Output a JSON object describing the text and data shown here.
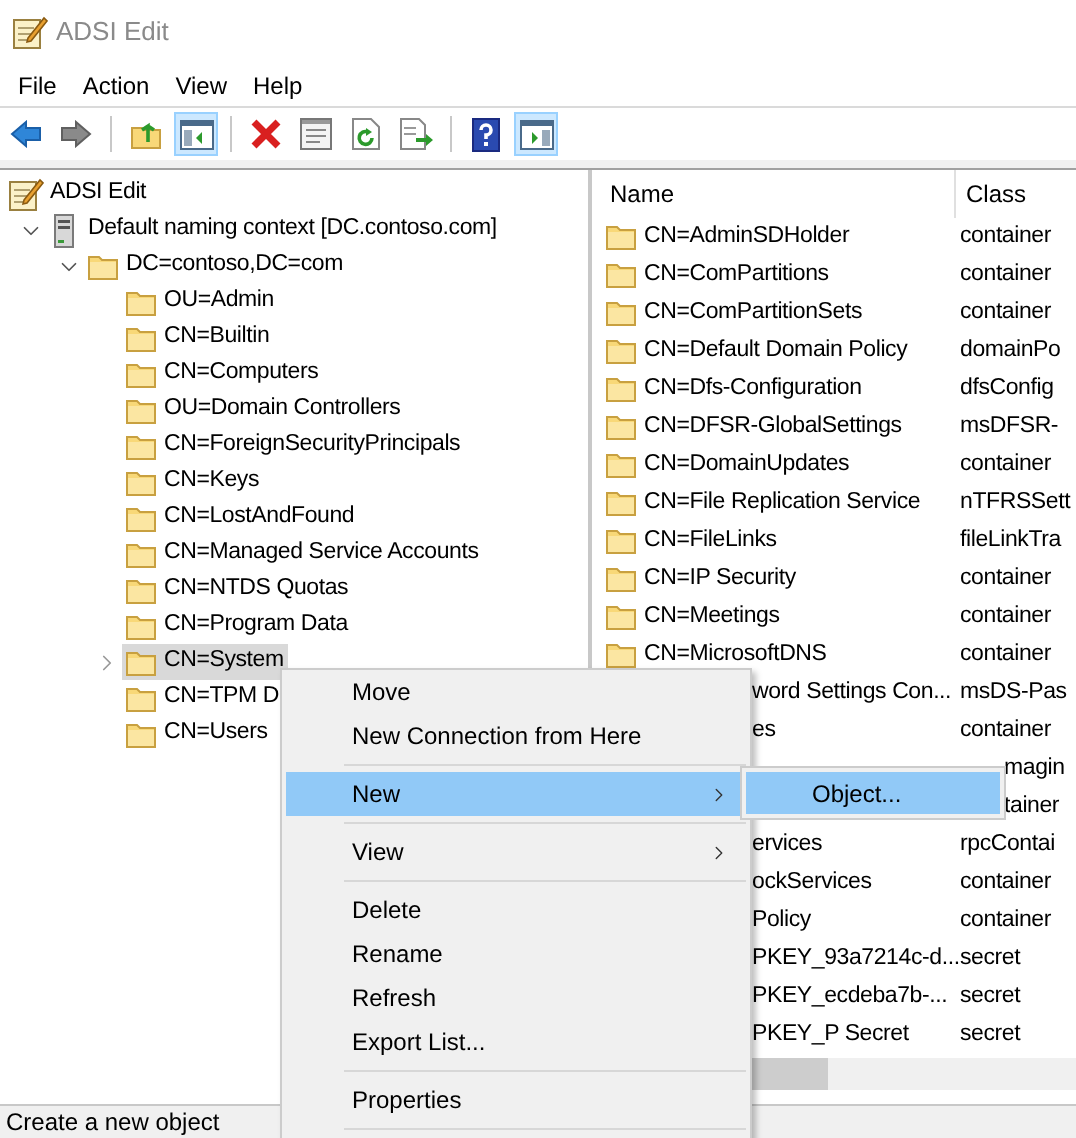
{
  "window": {
    "title": "ADSI Edit"
  },
  "menu_bar": [
    "File",
    "Action",
    "View",
    "Help"
  ],
  "toolbar": [
    {
      "kind": "back",
      "pressed": false,
      "disabled": false
    },
    {
      "kind": "forward",
      "pressed": false,
      "disabled": true
    },
    {
      "kind": "separator"
    },
    {
      "kind": "up",
      "pressed": false
    },
    {
      "kind": "tree-toggle",
      "pressed": true
    },
    {
      "kind": "separator"
    },
    {
      "kind": "delete",
      "pressed": false
    },
    {
      "kind": "properties",
      "pressed": false
    },
    {
      "kind": "refresh",
      "pressed": false
    },
    {
      "kind": "export",
      "pressed": false
    },
    {
      "kind": "separator"
    },
    {
      "kind": "help",
      "pressed": false
    },
    {
      "kind": "action-toggle",
      "pressed": true
    }
  ],
  "tree": [
    {
      "label": "ADSI Edit",
      "kind": "adsi",
      "selected": false,
      "children": [
        {
          "label": "Default naming context [DC.contoso.com]",
          "kind": "server",
          "expanded": true,
          "selected": false,
          "children": [
            {
              "label": "DC=contoso,DC=com",
              "kind": "folder",
              "expanded": true,
              "selected": false,
              "children": [
                {
                  "label": "OU=Admin",
                  "kind": "folder",
                  "selected": false
                },
                {
                  "label": "CN=Builtin",
                  "kind": "folder",
                  "selected": false
                },
                {
                  "label": "CN=Computers",
                  "kind": "folder",
                  "selected": false
                },
                {
                  "label": "OU=Domain Controllers",
                  "kind": "folder",
                  "selected": false
                },
                {
                  "label": "CN=ForeignSecurityPrincipals",
                  "kind": "folder",
                  "selected": false
                },
                {
                  "label": "CN=Keys",
                  "kind": "folder",
                  "selected": false
                },
                {
                  "label": "CN=LostAndFound",
                  "kind": "folder",
                  "selected": false
                },
                {
                  "label": "CN=Managed Service Accounts",
                  "kind": "folder",
                  "selected": false
                },
                {
                  "label": "CN=NTDS Quotas",
                  "kind": "folder",
                  "selected": false
                },
                {
                  "label": "CN=Program Data",
                  "kind": "folder",
                  "selected": false
                },
                {
                  "label": "CN=System",
                  "kind": "folder",
                  "expanded": false,
                  "selected": true
                },
                {
                  "label": "CN=TPM D",
                  "kind": "folder",
                  "selected": false
                },
                {
                  "label": "CN=Users",
                  "kind": "folder",
                  "selected": false
                }
              ]
            }
          ]
        }
      ]
    }
  ],
  "list": {
    "columns": [
      "Name",
      "Class"
    ],
    "rows": [
      {
        "kind": "full",
        "name": "CN=AdminSDHolder",
        "class": "container"
      },
      {
        "kind": "full",
        "name": "CN=ComPartitions",
        "class": "container"
      },
      {
        "kind": "full",
        "name": "CN=ComPartitionSets",
        "class": "container"
      },
      {
        "kind": "full",
        "name": "CN=Default Domain Policy",
        "class": "domainPo"
      },
      {
        "kind": "full",
        "name": "CN=Dfs-Configuration",
        "class": "dfsConfig"
      },
      {
        "kind": "full",
        "name": "CN=DFSR-GlobalSettings",
        "class": "msDFSR-"
      },
      {
        "kind": "full",
        "name": "CN=DomainUpdates",
        "class": "container"
      },
      {
        "kind": "full",
        "name": "CN=File Replication Service",
        "class": "nTFRSSett"
      },
      {
        "kind": "full",
        "name": "CN=FileLinks",
        "class": "fileLinkTra"
      },
      {
        "kind": "full",
        "name": "CN=IP Security",
        "class": "container"
      },
      {
        "kind": "full",
        "name": "CN=Meetings",
        "class": "container"
      },
      {
        "kind": "full",
        "name": "CN=MicrosoftDNS",
        "class": "container"
      },
      {
        "kind": "name-cut",
        "name": "word Settings Con...",
        "class": "msDS-Pas"
      },
      {
        "kind": "name-cut",
        "name": "es",
        "class": "container"
      },
      {
        "kind": "class-cut",
        "class": "magin"
      },
      {
        "kind": "class-cut",
        "class": "tainer"
      },
      {
        "kind": "name-cut",
        "name": "ervices",
        "class": "rpcContai"
      },
      {
        "kind": "name-cut",
        "name": "ockServices",
        "class": "container"
      },
      {
        "kind": "name-cut",
        "name": "Policy",
        "class": "container"
      },
      {
        "kind": "name-cut",
        "name": "PKEY_93a7214c-d...",
        "class": "secret"
      },
      {
        "kind": "name-cut",
        "name": "PKEY_ecdeba7b-...",
        "class": "secret"
      },
      {
        "kind": "name-cut",
        "name": "PKEY_P Secret",
        "class": "secret"
      }
    ]
  },
  "context_menu": {
    "items": [
      {
        "kind": "item",
        "label": "Move",
        "submenu": false,
        "selected": false
      },
      {
        "kind": "item",
        "label": "New Connection from Here",
        "submenu": false,
        "selected": false
      },
      {
        "kind": "separator"
      },
      {
        "kind": "item",
        "label": "New",
        "submenu": true,
        "selected": true
      },
      {
        "kind": "separator"
      },
      {
        "kind": "item",
        "label": "View",
        "submenu": true,
        "selected": false
      },
      {
        "kind": "separator"
      },
      {
        "kind": "item",
        "label": "Delete",
        "submenu": false,
        "selected": false
      },
      {
        "kind": "item",
        "label": "Rename",
        "submenu": false,
        "selected": false
      },
      {
        "kind": "item",
        "label": "Refresh",
        "submenu": false,
        "selected": false
      },
      {
        "kind": "item",
        "label": "Export List...",
        "submenu": false,
        "selected": false
      },
      {
        "kind": "separator"
      },
      {
        "kind": "item",
        "label": "Properties",
        "submenu": false,
        "selected": false
      },
      {
        "kind": "separator"
      }
    ],
    "submenu": [
      {
        "label": "Object...",
        "selected": true
      }
    ]
  },
  "status_bar": "Create a new object"
}
